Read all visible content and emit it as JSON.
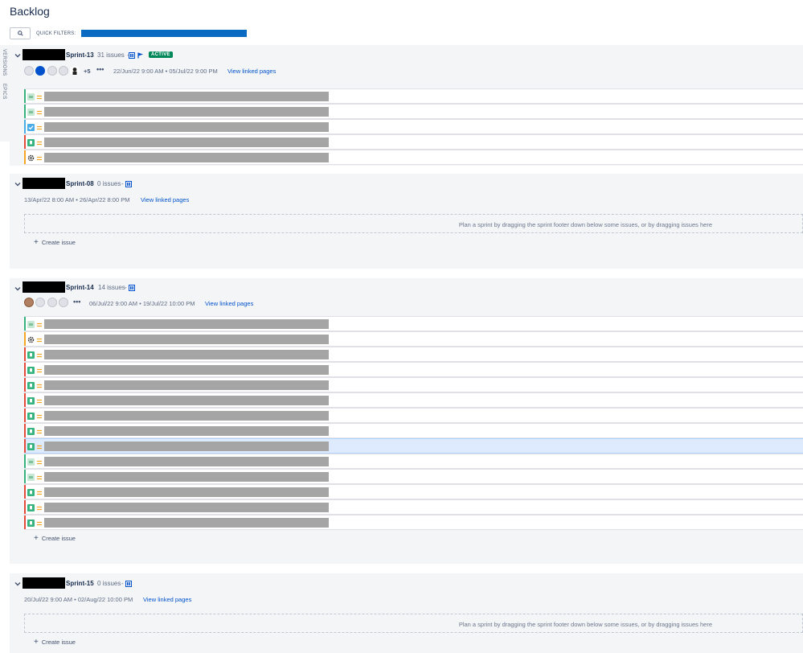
{
  "page": {
    "title": "Backlog"
  },
  "filters": {
    "label": "QUICK FILTERS:"
  },
  "side_tabs": [
    "VERSIONS",
    "EPICS"
  ],
  "common": {
    "view_linked": "View linked pages",
    "create_issue": "Create issue",
    "plan_hint": "Plan a sprint by dragging the sprint footer down below some issues, or by dragging issues here",
    "active_badge": "ACTIVE"
  },
  "sprints": [
    {
      "name": "Sprint-13",
      "count": "31 issues",
      "dates": "22/Jun/22 9:00 AM • 05/Jul/22 9:00 PM",
      "extra_assignees": "+5",
      "active": true,
      "issues": [
        {
          "type": "story",
          "color": "#36b37e"
        },
        {
          "type": "story",
          "color": "#36b37e"
        },
        {
          "type": "task",
          "color": "#4bade8"
        },
        {
          "type": "bug",
          "color": "#e5493a"
        },
        {
          "type": "gear",
          "color": "#f5a623"
        }
      ]
    },
    {
      "name": "Sprint-08",
      "count": "0 issues",
      "dates": "13/Apr/22 8:00 AM • 26/Apr/22 8:00 PM",
      "issues": []
    },
    {
      "name": "Sprint-14",
      "count": "14 issues",
      "dates": "06/Jul/22 9:00 AM • 19/Jul/22 10:00 PM",
      "issues": [
        {
          "type": "story",
          "color": "#36b37e"
        },
        {
          "type": "gear",
          "color": "#f5a623"
        },
        {
          "type": "bug",
          "color": "#e5493a"
        },
        {
          "type": "bug",
          "color": "#e5493a"
        },
        {
          "type": "bug",
          "color": "#e5493a"
        },
        {
          "type": "bug",
          "color": "#e5493a"
        },
        {
          "type": "bug",
          "color": "#e5493a"
        },
        {
          "type": "bug",
          "color": "#e5493a"
        },
        {
          "type": "bug",
          "color": "#e5493a",
          "selected": true
        },
        {
          "type": "story",
          "color": "#36b37e"
        },
        {
          "type": "story",
          "color": "#36b37e"
        },
        {
          "type": "bug",
          "color": "#e5493a"
        },
        {
          "type": "bug",
          "color": "#e5493a"
        },
        {
          "type": "bug",
          "color": "#e5493a"
        }
      ]
    },
    {
      "name": "Sprint-15",
      "count": "0 issues",
      "dates": "20/Jul/22 9:00 AM • 02/Aug/22 10:00 PM",
      "issues": []
    }
  ]
}
